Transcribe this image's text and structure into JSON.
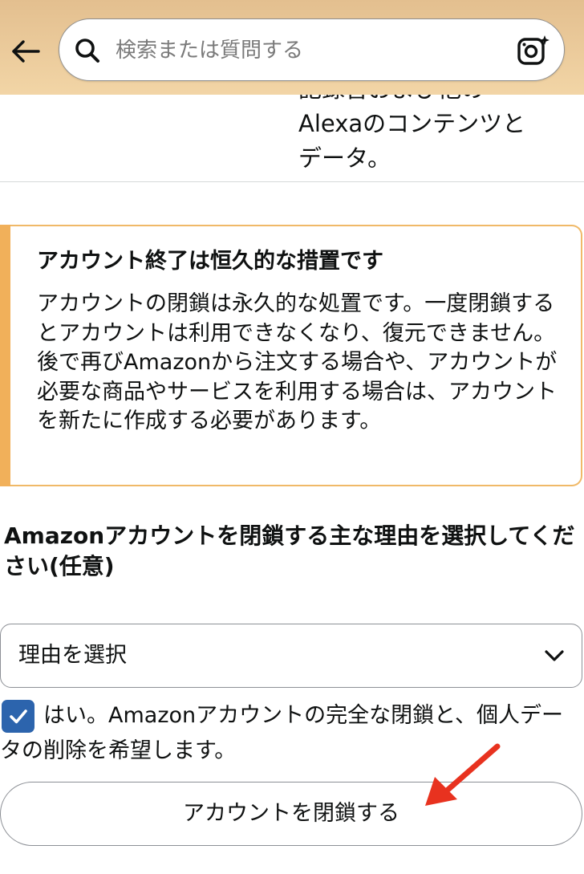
{
  "header": {
    "back_icon": "arrow-left-icon",
    "search": {
      "placeholder": "検索または質問する",
      "search_icon": "search-icon",
      "camera_icon": "camera-icon"
    }
  },
  "content": {
    "partial_text_line1": "記録音および他の",
    "partial_text_line2": "Alexaのコンテンツと",
    "partial_text_line3": "データ。",
    "alert": {
      "title": "アカウント終了は恒久的な措置です",
      "body": "アカウントの閉鎖は永久的な処置です。一度閉鎖するとアカウントは利用できなくなり、復元できません。後で再びAmazonから注文する場合や、アカウントが必要な商品やサービスを利用する場合は、アカウントを新たに作成する必要があります。"
    },
    "reason_heading": "Amazonアカウントを閉鎖する主な理由を選択してください(任意)",
    "reason_select": {
      "selected": "理由を選択",
      "icon": "chevron-down-icon"
    },
    "confirm_checkbox": {
      "checked": true,
      "label": "はい。Amazonアカウントの完全な閉鎖と、個人データの削除を希望します。"
    },
    "close_account_button": "アカウントを閉鎖する"
  },
  "colors": {
    "header_bg": "#e8c596",
    "alert_accent": "#f1b05a",
    "checkbox": "#2c64ad",
    "annotation_arrow": "#e8321f"
  }
}
